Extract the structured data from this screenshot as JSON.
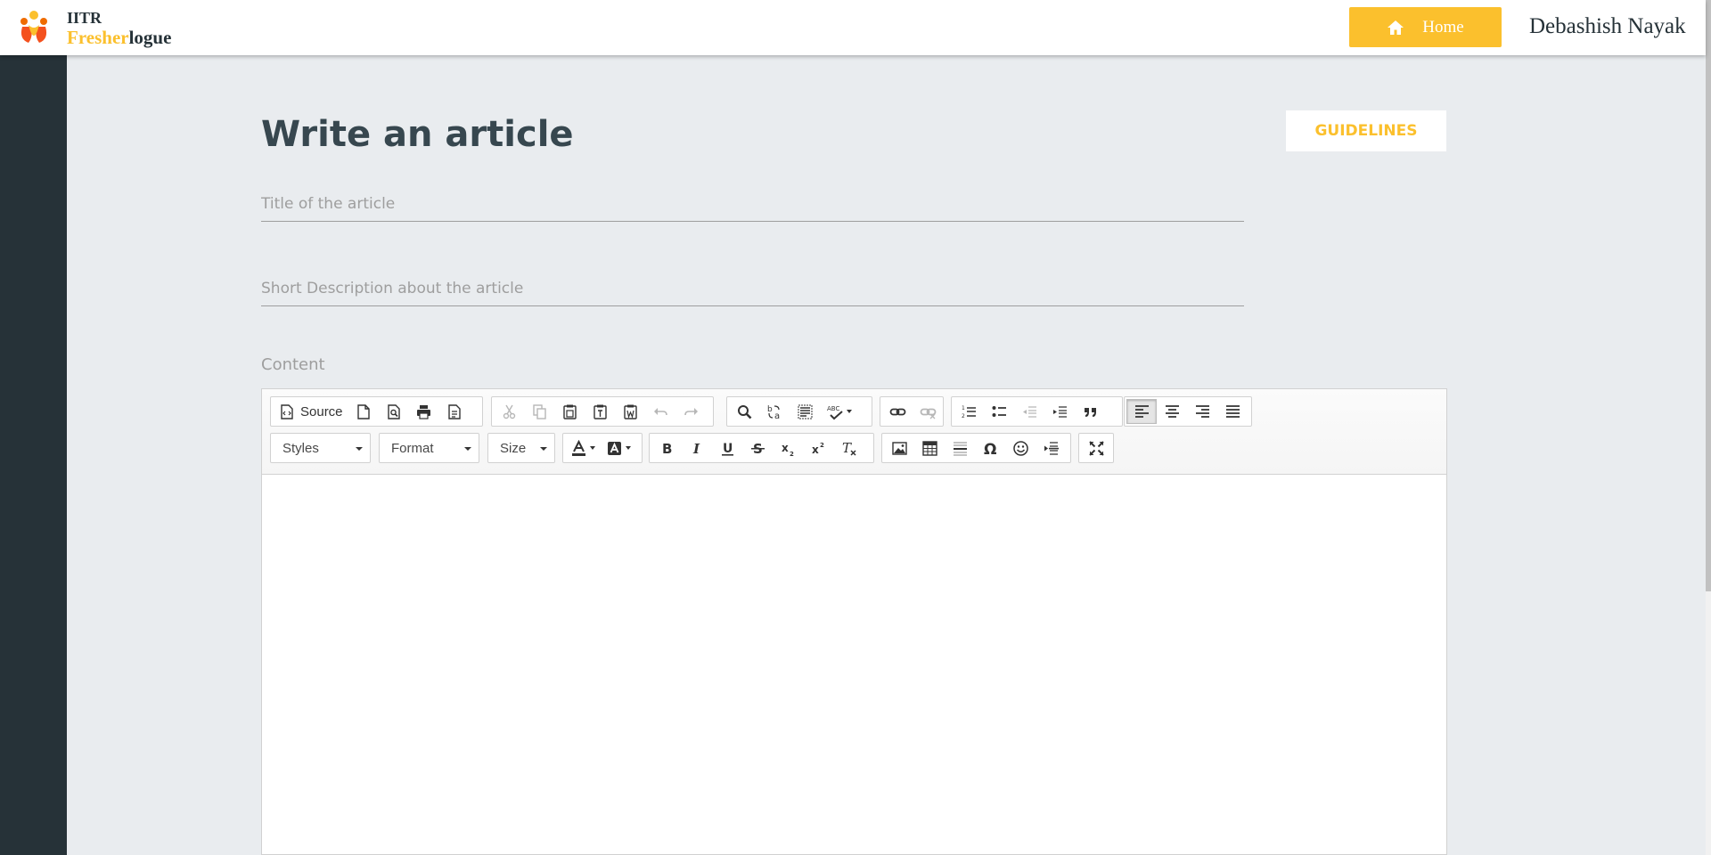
{
  "header": {
    "brand_line1": "IITR",
    "brand_accent": "Fresher",
    "brand_rest": "logue",
    "home_label": "Home",
    "user_name": "Debashish Nayak",
    "colors": {
      "accent": "#fbc02d",
      "dark": "#263238"
    }
  },
  "page": {
    "title": "Write an article",
    "guidelines_label": "GUIDELINES",
    "title_placeholder": "Title of the article",
    "description_placeholder": "Short Description about the article",
    "content_label": "Content"
  },
  "editor": {
    "source_label": "Source",
    "styles_label": "Styles",
    "format_label": "Format",
    "size_label": "Size",
    "icons_row1": [
      "source-icon",
      "new-page-icon",
      "preview-icon",
      "print-icon",
      "templates-icon",
      "cut-icon",
      "copy-icon",
      "paste-icon",
      "paste-text-icon",
      "paste-word-icon",
      "undo-icon",
      "redo-icon",
      "find-icon",
      "replace-icon",
      "select-all-icon",
      "spellcheck-icon",
      "link-icon",
      "unlink-icon",
      "numbered-list-icon",
      "bulleted-list-icon",
      "outdent-icon",
      "indent-icon",
      "blockquote-icon",
      "align-left-icon",
      "align-center-icon",
      "align-right-icon",
      "justify-icon"
    ],
    "icons_row2": [
      "text-color-icon",
      "background-color-icon",
      "bold-icon",
      "italic-icon",
      "underline-icon",
      "strikethrough-icon",
      "subscript-icon",
      "superscript-icon",
      "remove-format-icon",
      "image-icon",
      "table-icon",
      "horizontal-line-icon",
      "special-char-icon",
      "smiley-icon",
      "page-break-icon",
      "maximize-icon"
    ]
  }
}
